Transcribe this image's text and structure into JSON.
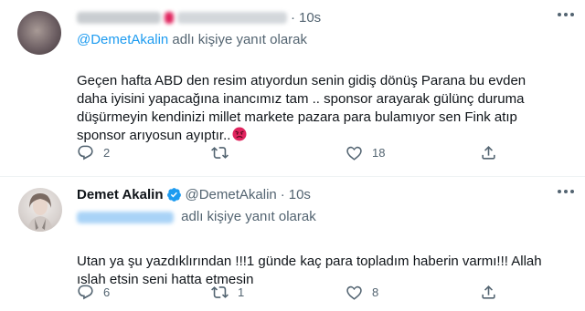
{
  "tweets": [
    {
      "name": "",
      "handle": "",
      "time": "10s",
      "reply_prefix": "",
      "reply_handle": "@DemetAkalin",
      "reply_suffix": " adlı kişiye yanıt olarak",
      "text": "Geçen hafta ABD den resim atıyordun senin gidiş dönüş Parana bu evden\ndaha iyisini yapacağına inancımız tam .. sponsor arayarak gülünç duruma\ndüşürmeyin kendinizi millet markete pazara para bulamıyor sen Fink atıp\nsponsor arıyosun ayıptır..",
      "emoji_icon": "angry-face-icon",
      "replies": "2",
      "retweets": "",
      "likes": "18"
    },
    {
      "name": "Demet Akalin",
      "handle": "@DemetAkalin",
      "time": "10s",
      "reply_handle": "",
      "reply_suffix": "adlı kişiye yanıt olarak",
      "text": "Utan ya şu yazdıklırından !!!1 günde kaç para topladım haberin varmı!!! Allah\nıslah etsin seni hatta etmesin",
      "verified_color": "#1d9bf0",
      "replies": "6",
      "retweets": "1",
      "likes": "8"
    }
  ]
}
